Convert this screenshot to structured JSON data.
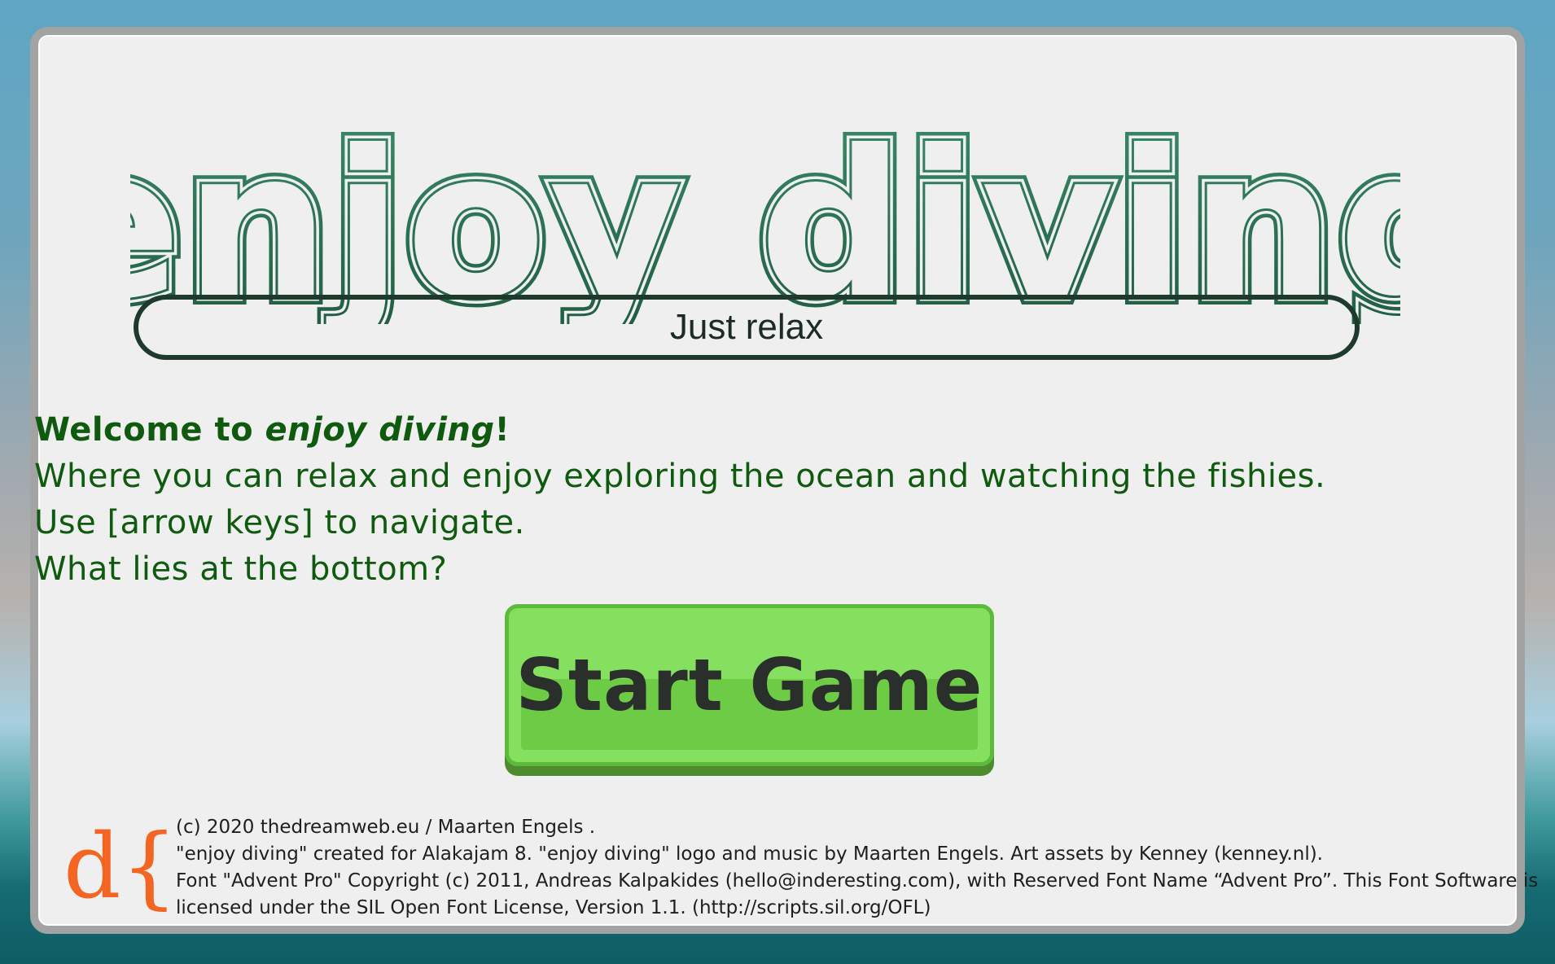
{
  "logo": {
    "text": "enjoy diving"
  },
  "tagline": "Just relax",
  "intro": {
    "welcome_prefix": "Welcome to ",
    "welcome_title": "enjoy diving",
    "welcome_suffix": "!",
    "line2": "Where you can relax and enjoy exploring the ocean and watching the fishies.",
    "line3": "Use [arrow keys] to navigate.",
    "line4": "What lies at the bottom?"
  },
  "start_button": {
    "label": "Start Game"
  },
  "credits": {
    "brand_logo": "d{",
    "line1": "(c) 2020 thedreamweb.eu / Maarten Engels .",
    "line2": "\"enjoy diving\" created for Alakajam 8. \"enjoy diving\" logo and music by Maarten Engels. Art assets by Kenney (kenney.nl).",
    "line3": "Font \"Advent Pro\" Copyright (c) 2011, Andreas Kalpakides (hello@inderesting.com), with Reserved Font Name “Advent Pro”. This Font Software is",
    "line4": "licensed under the SIL Open Font License, Version 1.1. (http://scripts.sil.org/OFL)"
  },
  "colors": {
    "logo_green": "#2f7a5a",
    "text_green": "#0f5a0f",
    "button_green": "#86e060",
    "brand_orange": "#f26522"
  }
}
